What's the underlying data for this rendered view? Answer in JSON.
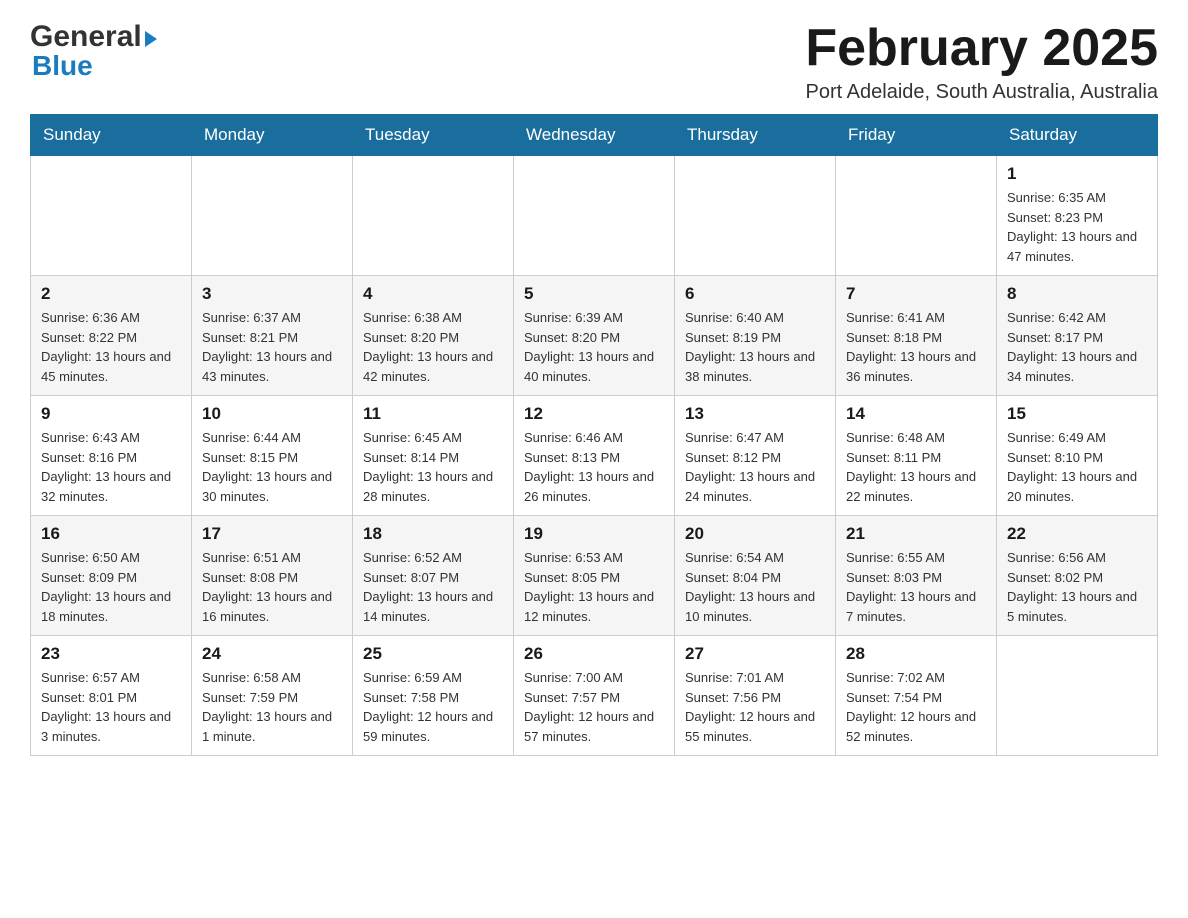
{
  "header": {
    "logo": {
      "general": "General",
      "arrow": "▶",
      "blue": "Blue"
    },
    "title": "February 2025",
    "location": "Port Adelaide, South Australia, Australia"
  },
  "weekdays": [
    "Sunday",
    "Monday",
    "Tuesday",
    "Wednesday",
    "Thursday",
    "Friday",
    "Saturday"
  ],
  "weeks": [
    {
      "days": [
        {
          "number": "",
          "info": ""
        },
        {
          "number": "",
          "info": ""
        },
        {
          "number": "",
          "info": ""
        },
        {
          "number": "",
          "info": ""
        },
        {
          "number": "",
          "info": ""
        },
        {
          "number": "",
          "info": ""
        },
        {
          "number": "1",
          "info": "Sunrise: 6:35 AM\nSunset: 8:23 PM\nDaylight: 13 hours and 47 minutes."
        }
      ]
    },
    {
      "days": [
        {
          "number": "2",
          "info": "Sunrise: 6:36 AM\nSunset: 8:22 PM\nDaylight: 13 hours and 45 minutes."
        },
        {
          "number": "3",
          "info": "Sunrise: 6:37 AM\nSunset: 8:21 PM\nDaylight: 13 hours and 43 minutes."
        },
        {
          "number": "4",
          "info": "Sunrise: 6:38 AM\nSunset: 8:20 PM\nDaylight: 13 hours and 42 minutes."
        },
        {
          "number": "5",
          "info": "Sunrise: 6:39 AM\nSunset: 8:20 PM\nDaylight: 13 hours and 40 minutes."
        },
        {
          "number": "6",
          "info": "Sunrise: 6:40 AM\nSunset: 8:19 PM\nDaylight: 13 hours and 38 minutes."
        },
        {
          "number": "7",
          "info": "Sunrise: 6:41 AM\nSunset: 8:18 PM\nDaylight: 13 hours and 36 minutes."
        },
        {
          "number": "8",
          "info": "Sunrise: 6:42 AM\nSunset: 8:17 PM\nDaylight: 13 hours and 34 minutes."
        }
      ]
    },
    {
      "days": [
        {
          "number": "9",
          "info": "Sunrise: 6:43 AM\nSunset: 8:16 PM\nDaylight: 13 hours and 32 minutes."
        },
        {
          "number": "10",
          "info": "Sunrise: 6:44 AM\nSunset: 8:15 PM\nDaylight: 13 hours and 30 minutes."
        },
        {
          "number": "11",
          "info": "Sunrise: 6:45 AM\nSunset: 8:14 PM\nDaylight: 13 hours and 28 minutes."
        },
        {
          "number": "12",
          "info": "Sunrise: 6:46 AM\nSunset: 8:13 PM\nDaylight: 13 hours and 26 minutes."
        },
        {
          "number": "13",
          "info": "Sunrise: 6:47 AM\nSunset: 8:12 PM\nDaylight: 13 hours and 24 minutes."
        },
        {
          "number": "14",
          "info": "Sunrise: 6:48 AM\nSunset: 8:11 PM\nDaylight: 13 hours and 22 minutes."
        },
        {
          "number": "15",
          "info": "Sunrise: 6:49 AM\nSunset: 8:10 PM\nDaylight: 13 hours and 20 minutes."
        }
      ]
    },
    {
      "days": [
        {
          "number": "16",
          "info": "Sunrise: 6:50 AM\nSunset: 8:09 PM\nDaylight: 13 hours and 18 minutes."
        },
        {
          "number": "17",
          "info": "Sunrise: 6:51 AM\nSunset: 8:08 PM\nDaylight: 13 hours and 16 minutes."
        },
        {
          "number": "18",
          "info": "Sunrise: 6:52 AM\nSunset: 8:07 PM\nDaylight: 13 hours and 14 minutes."
        },
        {
          "number": "19",
          "info": "Sunrise: 6:53 AM\nSunset: 8:05 PM\nDaylight: 13 hours and 12 minutes."
        },
        {
          "number": "20",
          "info": "Sunrise: 6:54 AM\nSunset: 8:04 PM\nDaylight: 13 hours and 10 minutes."
        },
        {
          "number": "21",
          "info": "Sunrise: 6:55 AM\nSunset: 8:03 PM\nDaylight: 13 hours and 7 minutes."
        },
        {
          "number": "22",
          "info": "Sunrise: 6:56 AM\nSunset: 8:02 PM\nDaylight: 13 hours and 5 minutes."
        }
      ]
    },
    {
      "days": [
        {
          "number": "23",
          "info": "Sunrise: 6:57 AM\nSunset: 8:01 PM\nDaylight: 13 hours and 3 minutes."
        },
        {
          "number": "24",
          "info": "Sunrise: 6:58 AM\nSunset: 7:59 PM\nDaylight: 13 hours and 1 minute."
        },
        {
          "number": "25",
          "info": "Sunrise: 6:59 AM\nSunset: 7:58 PM\nDaylight: 12 hours and 59 minutes."
        },
        {
          "number": "26",
          "info": "Sunrise: 7:00 AM\nSunset: 7:57 PM\nDaylight: 12 hours and 57 minutes."
        },
        {
          "number": "27",
          "info": "Sunrise: 7:01 AM\nSunset: 7:56 PM\nDaylight: 12 hours and 55 minutes."
        },
        {
          "number": "28",
          "info": "Sunrise: 7:02 AM\nSunset: 7:54 PM\nDaylight: 12 hours and 52 minutes."
        },
        {
          "number": "",
          "info": ""
        }
      ]
    }
  ]
}
